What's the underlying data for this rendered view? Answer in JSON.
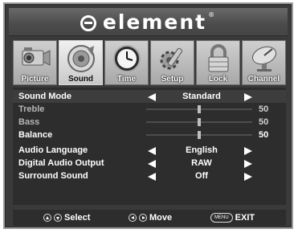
{
  "brand": {
    "name": "element",
    "reg": "®"
  },
  "tabs": [
    {
      "label": "Picture",
      "icon": "camcorder-icon"
    },
    {
      "label": "Sound",
      "icon": "speaker-icon"
    },
    {
      "label": "Time",
      "icon": "clock-icon"
    },
    {
      "label": "Setup",
      "icon": "gear-icon"
    },
    {
      "label": "Lock",
      "icon": "padlock-icon"
    },
    {
      "label": "Channel",
      "icon": "satellite-dish-icon"
    }
  ],
  "active_tab": "Sound",
  "menu": {
    "sound_mode": {
      "label": "Sound Mode",
      "value": "Standard"
    },
    "treble": {
      "label": "Treble",
      "value": "50",
      "level": 50
    },
    "bass": {
      "label": "Bass",
      "value": "50",
      "level": 50
    },
    "balance": {
      "label": "Balance",
      "value": "50",
      "level": 50
    },
    "audio_language": {
      "label": "Audio Language",
      "value": "English"
    },
    "digital_audio_output": {
      "label": "Digital Audio Output",
      "value": "RAW"
    },
    "surround_sound": {
      "label": "Surround Sound",
      "value": "Off"
    }
  },
  "footer": {
    "select": "Select",
    "move": "Move",
    "menu_key": "MENU",
    "exit": "EXIT"
  },
  "colors": {
    "panel": "#3a3a3a",
    "menu_bg": "#2d2d2d",
    "text": "#ffffff"
  }
}
